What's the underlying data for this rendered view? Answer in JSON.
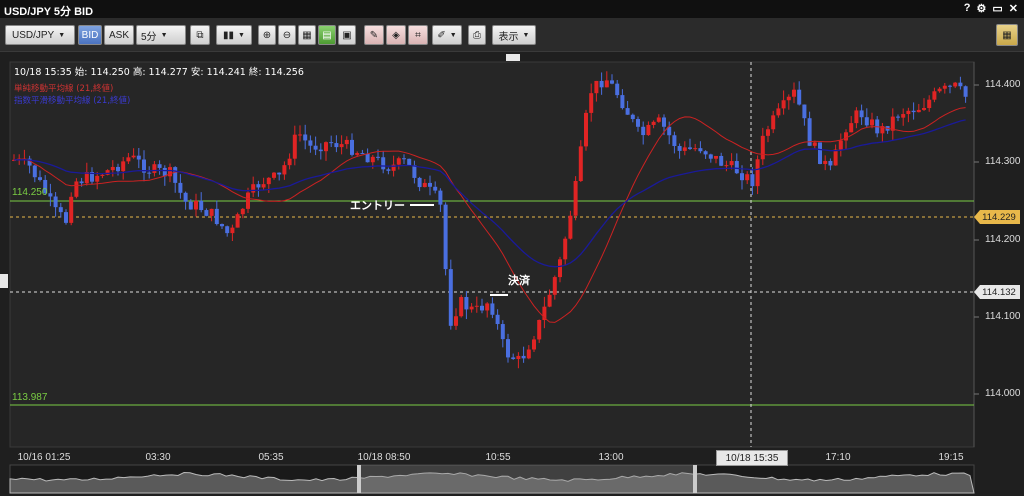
{
  "window": {
    "title": "USD/JPY 5分 BID",
    "controls": [
      "?",
      "⚙",
      "▭",
      "✕"
    ]
  },
  "toolbar": {
    "symbol": "USD/JPY",
    "bid_label": "BID",
    "ask_label": "ASK",
    "timeframe": "5分",
    "display_label": "表示"
  },
  "chart": {
    "info": "10/18 15:35  始: 114.250  高: 114.277  安: 114.241  終: 114.256",
    "legend_sma": "単純移動平均線 (21,終値)",
    "legend_ema": "指数平滑移動平均線 (21,終値)",
    "hline_upper_label": "114.250",
    "hline_lower_label": "113.987",
    "current_price_tag": "114.229",
    "crosshair_price_tag": "114.132",
    "crosshair_time_tag": "10/18 15:35",
    "entry_label": "エントリー",
    "exit_label": "決済",
    "colors": {
      "up": "#e02424",
      "down": "#4a6fe0",
      "sma": "#cc2222",
      "ema": "#1a1a9a",
      "hline": "#7acc44",
      "tag": "#e8b84a"
    }
  },
  "chart_data": {
    "type": "candlestick",
    "ylim": [
      113.94,
      114.44
    ],
    "y_ticks": [
      "114.400",
      "114.300",
      "114.250",
      "114.200",
      "114.100",
      "114.000",
      "113.987"
    ],
    "x_ticks": [
      "10/16 01:25",
      "03:30",
      "05:35",
      "10/18 08:50",
      "10:55",
      "13:00",
      "15:05",
      "17:10",
      "19:15"
    ]
  }
}
